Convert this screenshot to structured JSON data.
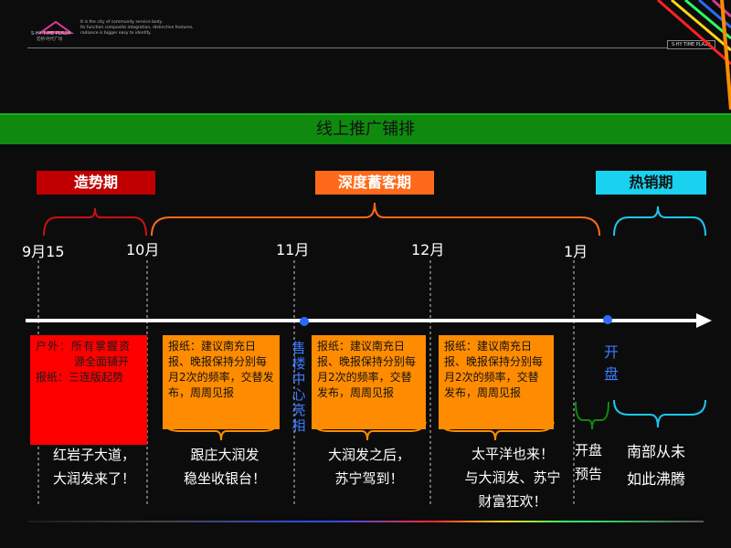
{
  "header": {
    "logo_brand": "S·HY TIME PLAZA",
    "logo_cn": "宏桥·时代广场",
    "tagline": [
      "It is the city of community service body.",
      "Its function composite integration, distinctive features,",
      "radiance is bigger easy to identify."
    ],
    "brand_right": "S·HY TIME PLAZA"
  },
  "title": "线上推广铺排",
  "phases": [
    {
      "label": "造势期",
      "color": "#c00000"
    },
    {
      "label": "深度蓄客期",
      "color": "#ff6a1a"
    },
    {
      "label": "热销期",
      "color": "#19d2f0"
    }
  ],
  "months": [
    "9月15",
    "10月",
    "11月",
    "12月",
    "1月"
  ],
  "boxes": {
    "outdoor": [
      "户外：所有掌握资",
      "源全面铺开",
      "报纸：三连版起势"
    ],
    "paper_text": "报纸：建议南充日报、晚报保持分别每月2次的频率，交替发布，周周见报"
  },
  "captions": {
    "c1": [
      "红岩子大道，",
      "大润发来了！"
    ],
    "c2": [
      "跟庄大润发",
      "稳坐收银台！"
    ],
    "c3": [
      "大润发之后，",
      "苏宁驾到！"
    ],
    "c4": [
      "太平洋也来！",
      "与大润发、苏宁",
      "财富狂欢！"
    ],
    "c5": [
      "开盘",
      "预告"
    ],
    "c6": [
      "南部从未",
      "如此沸腾"
    ]
  },
  "vertical_labels": {
    "sales_center": "售楼中心亮相",
    "opening": "开盘"
  }
}
